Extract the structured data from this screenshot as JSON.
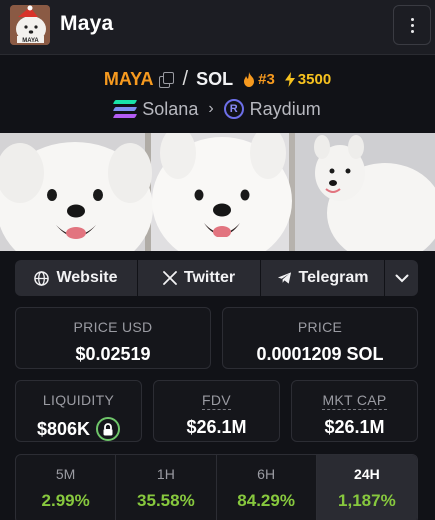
{
  "header": {
    "app_name": "Maya",
    "avatar_text": "MAYA"
  },
  "pair": {
    "base": "MAYA",
    "separator": "/",
    "quote": "SOL",
    "rank": "#3",
    "boosts": "3500"
  },
  "chain": {
    "network": "Solana",
    "dex": "Raydium"
  },
  "links": {
    "website": "Website",
    "twitter": "Twitter",
    "telegram": "Telegram"
  },
  "stats": {
    "price_usd": {
      "label": "PRICE USD",
      "value": "$0.02519"
    },
    "price_native": {
      "label": "PRICE",
      "value": "0.0001209 SOL"
    },
    "liquidity": {
      "label": "LIQUIDITY",
      "value": "$806K"
    },
    "fdv": {
      "label": "FDV",
      "value": "$26.1M"
    },
    "mkt_cap": {
      "label": "MKT CAP",
      "value": "$26.1M"
    }
  },
  "timeframes": [
    {
      "label": "5M",
      "value": "2.99%"
    },
    {
      "label": "1H",
      "value": "35.58%"
    },
    {
      "label": "6H",
      "value": "84.29%"
    },
    {
      "label": "24H",
      "value": "1,187%"
    }
  ],
  "colors": {
    "accent_orange": "#f79a1f",
    "positive_green": "#87c83e",
    "background": "#111217"
  }
}
